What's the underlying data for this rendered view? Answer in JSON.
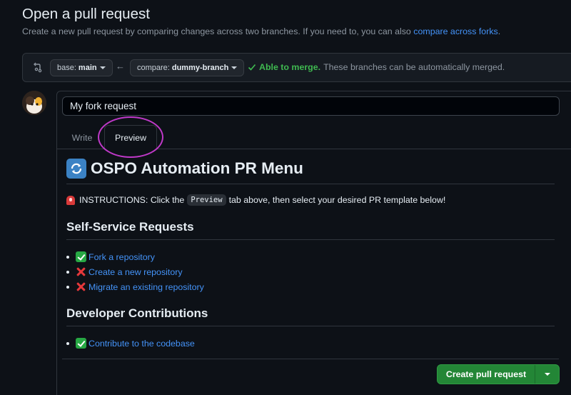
{
  "header": {
    "title": "Open a pull request",
    "subtitle": "Create a new pull request by comparing changes across two branches. If you need to, you can also",
    "subtitle_link": "compare across forks",
    "subtitle_end": "."
  },
  "compare": {
    "base_prefix": "base:",
    "base_branch": "main",
    "compare_prefix": "compare:",
    "compare_branch": "dummy-branch",
    "arrow": "←",
    "merge_ok": "Able to merge.",
    "merge_text": "These branches can be automatically merged."
  },
  "form": {
    "title_value": "My fork request",
    "tabs": [
      "Write",
      "Preview"
    ],
    "active_tab": "Preview"
  },
  "preview": {
    "heading": "OSPO Automation PR Menu",
    "instructions_before": "INSTRUCTIONS: Click the",
    "instructions_code": "Preview",
    "instructions_after": "tab above, then select your desired PR template below!",
    "sections": [
      {
        "title": "Self-Service Requests",
        "items": [
          {
            "status": "check",
            "label": "Fork a repository"
          },
          {
            "status": "cross",
            "label": "Create a new repository"
          },
          {
            "status": "cross",
            "label": "Migrate an existing repository"
          }
        ]
      },
      {
        "title": "Developer Contributions",
        "items": [
          {
            "status": "check",
            "label": "Contribute to the codebase"
          }
        ]
      }
    ]
  },
  "actions": {
    "create_label": "Create pull request"
  },
  "colors": {
    "accent_link": "#4493f8",
    "success": "#3fb950",
    "button_green": "#238636",
    "annotation_circle": "#c039c9"
  }
}
